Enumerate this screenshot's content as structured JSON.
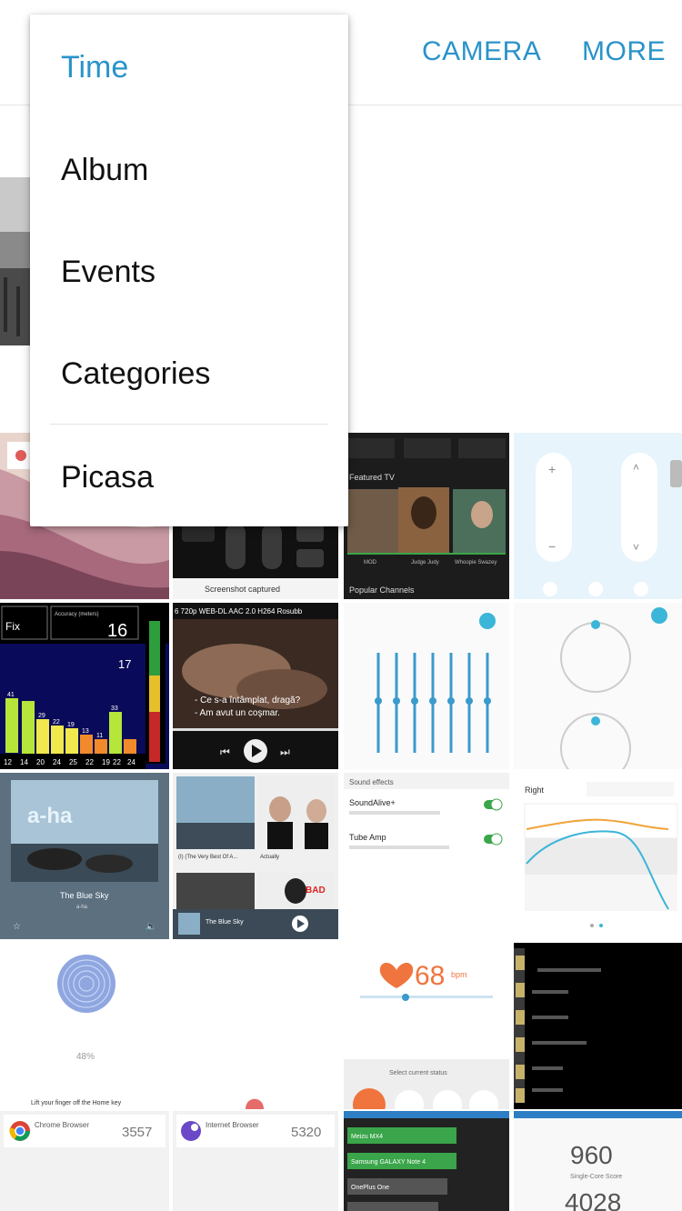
{
  "header": {
    "camera_label": "CAMERA",
    "more_label": "MORE"
  },
  "view_menu": {
    "items": [
      {
        "label": "Time",
        "selected": true
      },
      {
        "label": "Album",
        "selected": false
      },
      {
        "label": "Events",
        "selected": false
      },
      {
        "label": "Categories",
        "selected": false
      },
      {
        "label": "Picasa",
        "selected": false
      }
    ]
  },
  "thumbnails": {
    "tv_channels": {
      "header": "Featured TV",
      "names": [
        "MOD",
        "Judge Judy",
        "Whoopie Swazey"
      ],
      "footer": "Popular Channels"
    },
    "remote_screenshot": {
      "caption": "Screenshot captured"
    },
    "signal_chart": {
      "left_label": "Fix",
      "accuracy_label": "Accuracy (meters)",
      "accuracy_value": "16",
      "value_2": "17",
      "bar_values": [
        "41",
        "29",
        "22",
        "19",
        "13",
        "11",
        "33"
      ],
      "x_labels": [
        "12",
        "14",
        "20",
        "24",
        "25",
        "22",
        "19",
        "22",
        "24"
      ]
    },
    "video_player": {
      "filename": "6 720p WEB-DL AAC 2.0 H264 Rosubb",
      "subtitle_line1": "- Ce s-a întâmplat, dragă?",
      "subtitle_line2": "- Am avut un coşmar."
    },
    "music_player": {
      "title": "The Blue Sky",
      "artist": "a-ha"
    },
    "music_library": {
      "album1": "(I) (The Very Best Of A...",
      "album2": "Actually",
      "now_playing": "The Blue Sky"
    },
    "sound_effects": {
      "header": "Sound effects",
      "item1": "SoundAlive+",
      "item2": "Tube Amp"
    },
    "right_ear_chart": {
      "title": "Right"
    },
    "fingerprint": {
      "percent": "48%",
      "instruction": "Lift your finger off the Home key"
    },
    "heart_rate": {
      "value": "68",
      "unit": "bpm",
      "status_label": "Select current status"
    },
    "benchmark_chrome": {
      "name": "Chrome Browser",
      "score": "3557"
    },
    "benchmark_internet": {
      "name": "Internet Browser",
      "score": "5320"
    },
    "device_list": {
      "items": [
        "Meizu MX4",
        "Samsung GALAXY Note 4",
        "OnePlus One"
      ]
    },
    "single_core": {
      "score": "960",
      "label": "Single-Core Score",
      "score2": "4028"
    }
  }
}
